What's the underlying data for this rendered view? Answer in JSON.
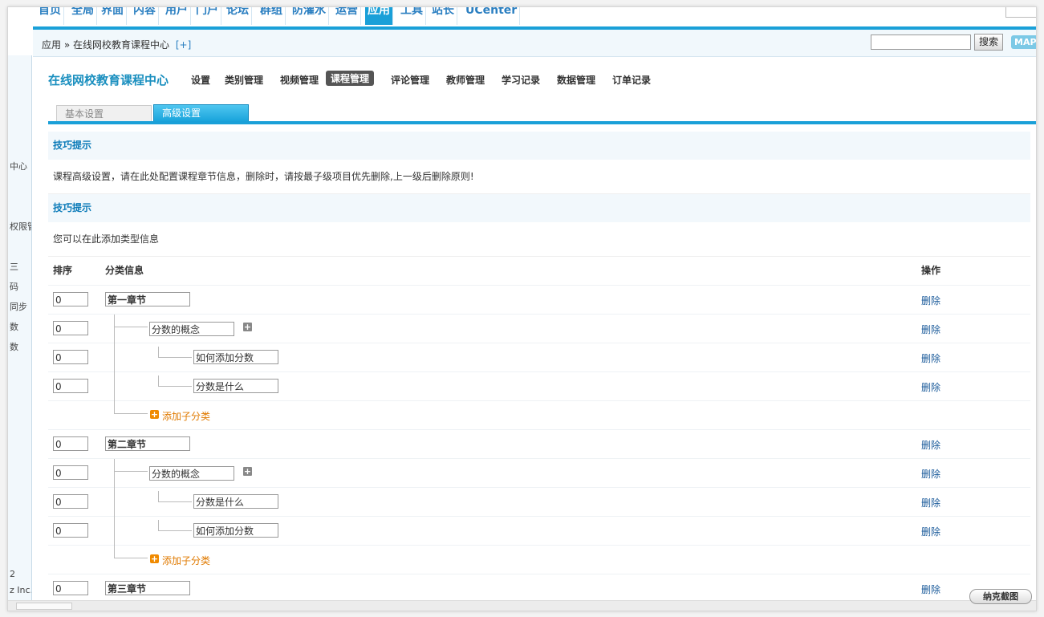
{
  "topnav": {
    "items": [
      "首页",
      "全局",
      "界面",
      "内容",
      "用户",
      "门户",
      "论坛",
      "群组",
      "防灌水",
      "运营",
      "应用",
      "工具",
      "站长",
      "UCenter"
    ],
    "active_index": 10
  },
  "sidebar": {
    "lines": [
      "中心",
      "权限管",
      "三",
      "码",
      "同步",
      "数",
      "数",
      "2",
      "z Inc."
    ]
  },
  "breadcrumb": {
    "app": "应用",
    "sep": "»",
    "page": "在线网校教育课程中心",
    "add": "[+]"
  },
  "search": {
    "button": "搜索",
    "map": "MAP"
  },
  "plugin": {
    "title": "在线网校教育课程中心",
    "menu": [
      "设置",
      "类别管理",
      "视频管理",
      "课程管理",
      "评论管理",
      "教师管理",
      "学习记录",
      "数据管理",
      "订单记录"
    ],
    "active_menu": 3
  },
  "tabs": {
    "basic": "基本设置",
    "advanced": "高级设置"
  },
  "tips": [
    {
      "title": "技巧提示",
      "text": "课程高级设置，请在此处配置课程章节信息，删除时，请按最子级项目优先删除,上一级后删除原则!"
    },
    {
      "title": "技巧提示",
      "text": "您可以在此添加类型信息"
    }
  ],
  "table": {
    "headers": {
      "order": "排序",
      "info": "分类信息",
      "op": "操作"
    },
    "delete_label": "删除",
    "add_sub_label": "添加子分类",
    "rows": [
      {
        "type": "chapter",
        "order": "0",
        "name": "第一章节"
      },
      {
        "type": "section",
        "order": "0",
        "name": "分数的概念"
      },
      {
        "type": "item",
        "order": "0",
        "name": "如何添加分数"
      },
      {
        "type": "item",
        "order": "0",
        "name": "分数是什么"
      },
      {
        "type": "add"
      },
      {
        "type": "chapter",
        "order": "0",
        "name": "第二章节"
      },
      {
        "type": "section",
        "order": "0",
        "name": "分数的概念"
      },
      {
        "type": "item",
        "order": "0",
        "name": "分数是什么"
      },
      {
        "type": "item",
        "order": "0",
        "name": "如何添加分数"
      },
      {
        "type": "add"
      },
      {
        "type": "chapter",
        "order": "0",
        "name": "第三章节"
      }
    ]
  },
  "badge": "纳克截图",
  "colors": {
    "accent": "#1aa0d8",
    "link": "#1a5a9a",
    "add": "#e07a00"
  }
}
